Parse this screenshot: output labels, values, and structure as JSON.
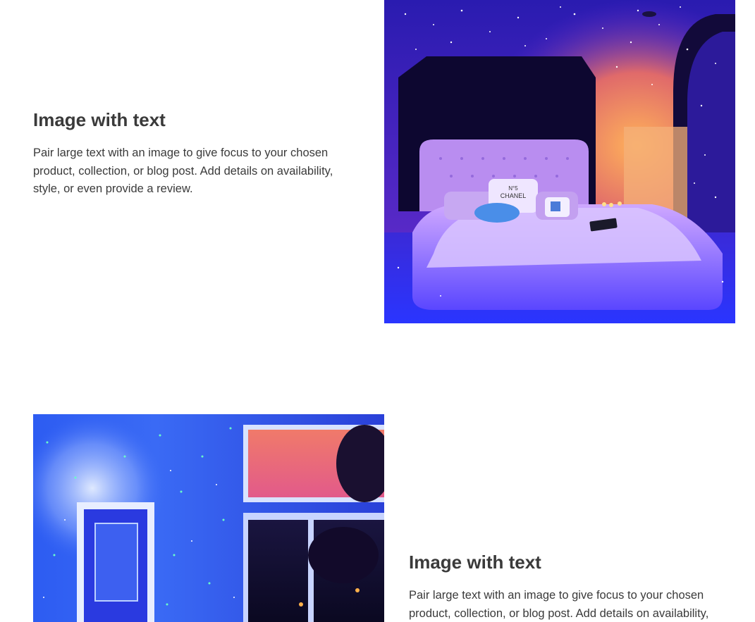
{
  "sections": [
    {
      "heading": "Image with text",
      "body": "Pair large text with an image to give focus to your chosen product, collection, or blog post. Add details on availability, style, or even provide a review.",
      "image": "bedroom-galaxy-projector-image",
      "pillow_text_line1": "N°5",
      "pillow_text_line2": "CHANEL"
    },
    {
      "heading": "Image with text",
      "body": "Pair large text with an image to give focus to your chosen product, collection, or blog post. Add details on availability, style, or even provide a review.",
      "image": "wall-galaxy-projector-image"
    }
  ]
}
